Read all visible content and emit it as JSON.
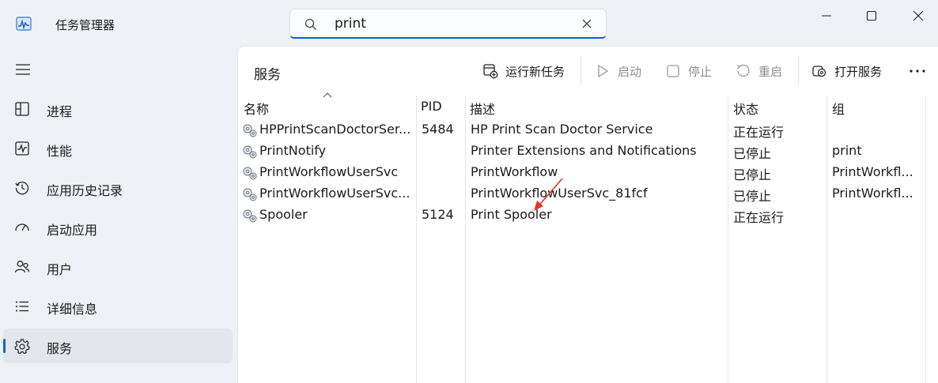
{
  "app": {
    "title": "任务管理器"
  },
  "search": {
    "value": "print"
  },
  "sidebar": {
    "items": [
      {
        "label": "进程",
        "icon": "processes-icon"
      },
      {
        "label": "性能",
        "icon": "performance-icon"
      },
      {
        "label": "应用历史记录",
        "icon": "app-history-icon"
      },
      {
        "label": "启动应用",
        "icon": "startup-icon"
      },
      {
        "label": "用户",
        "icon": "users-icon"
      },
      {
        "label": "详细信息",
        "icon": "details-icon"
      },
      {
        "label": "服务",
        "icon": "services-icon",
        "active": true
      }
    ]
  },
  "panel": {
    "title": "服务"
  },
  "toolbar": {
    "run_new_task": "运行新任务",
    "start": "启动",
    "stop": "停止",
    "restart": "重启",
    "open_services": "打开服务"
  },
  "table": {
    "headers": {
      "name": "名称",
      "pid": "PID",
      "description": "描述",
      "status": "状态",
      "group": "组"
    },
    "rows": [
      {
        "name": "HPPrintScanDoctorSer...",
        "pid": "5484",
        "description": "HP Print Scan Doctor Service",
        "status": "正在运行",
        "group": ""
      },
      {
        "name": "PrintNotify",
        "pid": "",
        "description": "Printer Extensions and Notifications",
        "status": "已停止",
        "group": "print"
      },
      {
        "name": "PrintWorkflowUserSvc",
        "pid": "",
        "description": "PrintWorkflow",
        "status": "已停止",
        "group": "PrintWorkfl..."
      },
      {
        "name": "PrintWorkflowUserSvc...",
        "pid": "",
        "description": "PrintWorkflowUserSvc_81fcf",
        "status": "已停止",
        "group": "PrintWorkfl..."
      },
      {
        "name": "Spooler",
        "pid": "5124",
        "description": "Print Spooler",
        "status": "正在运行",
        "group": ""
      }
    ]
  },
  "colors": {
    "accent": "#1a5fc4",
    "annotation_arrow": "#e8312a"
  }
}
